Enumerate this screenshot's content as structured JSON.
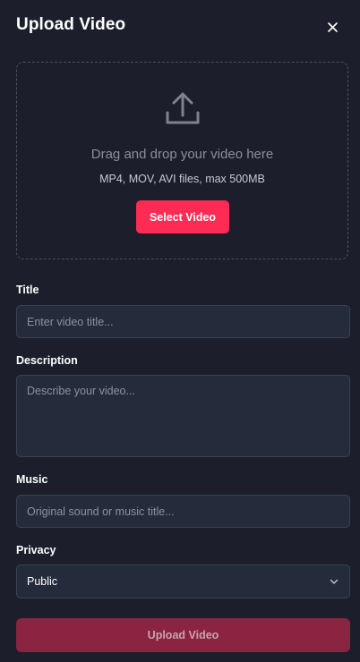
{
  "header": {
    "title": "Upload Video",
    "close_icon": "close-icon"
  },
  "dropzone": {
    "icon": "upload-icon",
    "text": "Drag and drop your video here",
    "subtext": "MP4, MOV, AVI files, max 500MB",
    "button_label": "Select Video"
  },
  "form": {
    "title": {
      "label": "Title",
      "value": "",
      "placeholder": "Enter video title..."
    },
    "description": {
      "label": "Description",
      "value": "",
      "placeholder": "Describe your video..."
    },
    "music": {
      "label": "Music",
      "value": "",
      "placeholder": "Original sound or music title..."
    },
    "privacy": {
      "label": "Privacy",
      "selected": "Public",
      "icon": "chevron-down-icon"
    }
  },
  "submit": {
    "label": "Upload Video",
    "disabled": true
  },
  "colors": {
    "background": "#1c1f2b",
    "accent": "#fe2c55",
    "accent_disabled": "#8a2441",
    "field_bg": "#242b3b"
  }
}
